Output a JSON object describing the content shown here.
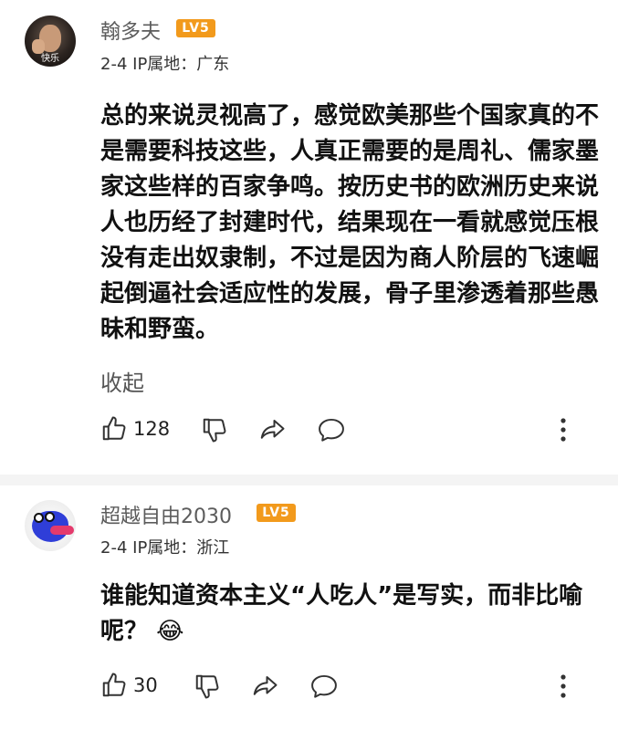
{
  "comments": [
    {
      "username": "翰多夫",
      "level": "LV5",
      "avatar_caption": "快乐",
      "date": "2-4",
      "ip_location": "IP属地：广东",
      "text": "总的来说灵视高了，感觉欧美那些个国家真的不是需要科技这些，人真正需要的是周礼、儒家墨家这些样的百家争鸣。按历史书的欧洲历史来说人也历经了封建时代，结果现在一看就感觉压根没有走出奴隶制，不过是因为商人阶层的飞速崛起倒逼社会适应性的发展，骨子里渗透着那些愚昧和野蛮。",
      "collapse_label": "收起",
      "likes": "128",
      "icons": [
        "thumbs-up-icon",
        "thumbs-down-icon",
        "share-icon",
        "reply-bubble-icon",
        "more-vertical-icon"
      ]
    },
    {
      "username": "超越自由2030",
      "level": "LV5",
      "date": "2-4",
      "ip_location": "IP属地：浙江",
      "text": "谁能知道资本主义“人吃人”是写实，而非比喻呢？",
      "emoji": "😂",
      "likes": "30",
      "icons": [
        "thumbs-up-icon",
        "thumbs-down-icon",
        "share-icon",
        "reply-bubble-icon",
        "more-vertical-icon"
      ]
    }
  ],
  "colors": {
    "level_badge": "#f29a1c",
    "username": "#5c5c5c",
    "text": "#111111",
    "divider": "#f4f4f4"
  }
}
